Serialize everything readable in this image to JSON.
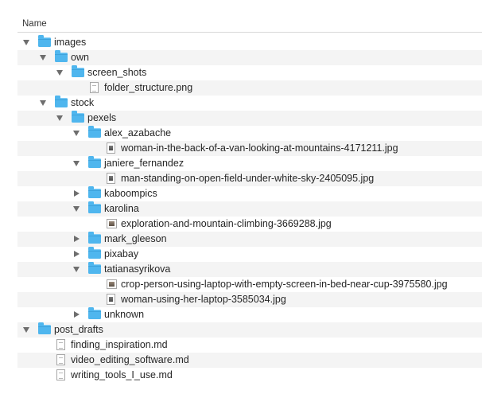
{
  "header": {
    "name_column": "Name"
  },
  "rows": [
    {
      "label": "images",
      "depth": 0,
      "kind": "folder",
      "state": "open"
    },
    {
      "label": "own",
      "depth": 1,
      "kind": "folder",
      "state": "open"
    },
    {
      "label": "screen_shots",
      "depth": 2,
      "kind": "folder",
      "state": "open"
    },
    {
      "label": "folder_structure.png",
      "depth": 3,
      "kind": "doc"
    },
    {
      "label": "stock",
      "depth": 1,
      "kind": "folder",
      "state": "open"
    },
    {
      "label": "pexels",
      "depth": 2,
      "kind": "folder",
      "state": "open"
    },
    {
      "label": "alex_azabache",
      "depth": 3,
      "kind": "folder",
      "state": "open"
    },
    {
      "label": "woman-in-the-back-of-a-van-looking-at-mountains-4171211.jpg",
      "depth": 4,
      "kind": "img"
    },
    {
      "label": "janiere_fernandez",
      "depth": 3,
      "kind": "folder",
      "state": "open"
    },
    {
      "label": "man-standing-on-open-field-under-white-sky-2405095.jpg",
      "depth": 4,
      "kind": "img"
    },
    {
      "label": "kaboompics",
      "depth": 3,
      "kind": "folder",
      "state": "closed"
    },
    {
      "label": "karolina",
      "depth": 3,
      "kind": "folder",
      "state": "open"
    },
    {
      "label": "exploration-and-mountain-climbing-3669288.jpg",
      "depth": 4,
      "kind": "img-wide"
    },
    {
      "label": "mark_gleeson",
      "depth": 3,
      "kind": "folder",
      "state": "closed"
    },
    {
      "label": "pixabay",
      "depth": 3,
      "kind": "folder",
      "state": "closed"
    },
    {
      "label": "tatianasyrikova",
      "depth": 3,
      "kind": "folder",
      "state": "open"
    },
    {
      "label": "crop-person-using-laptop-with-empty-screen-in-bed-near-cup-3975580.jpg",
      "depth": 4,
      "kind": "img-wide"
    },
    {
      "label": "woman-using-her-laptop-3585034.jpg",
      "depth": 4,
      "kind": "img"
    },
    {
      "label": "unknown",
      "depth": 3,
      "kind": "folder",
      "state": "closed"
    },
    {
      "label": "post_drafts",
      "depth": 0,
      "kind": "folder",
      "state": "open"
    },
    {
      "label": "finding_inspiration.md",
      "depth": 1,
      "kind": "doc"
    },
    {
      "label": "video_editing_software.md",
      "depth": 1,
      "kind": "doc"
    },
    {
      "label": "writing_tools_I_use.md",
      "depth": 1,
      "kind": "doc"
    }
  ]
}
